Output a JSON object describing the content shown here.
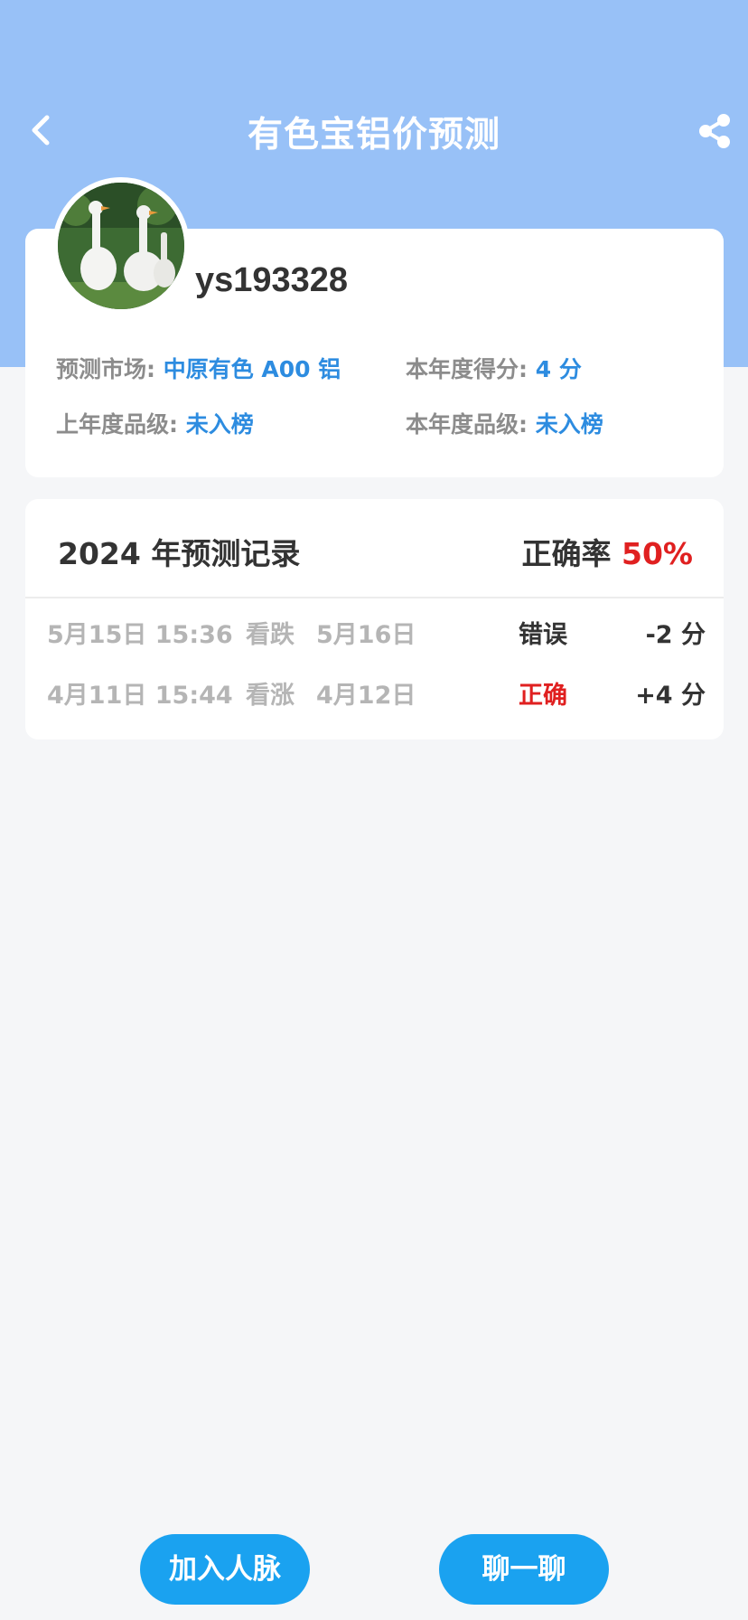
{
  "nav": {
    "title": "有色宝铝价预测"
  },
  "profile": {
    "username": "ys193328",
    "market_label": "预测市场:",
    "market_value": "中原有色 A00 铝",
    "score_label": "本年度得分:",
    "score_value": "4 分",
    "last_grade_label": "上年度品级:",
    "last_grade_value": "未入榜",
    "grade_label": "本年度品级:",
    "grade_value": "未入榜"
  },
  "records": {
    "title": "2024 年预测记录",
    "accuracy_label": "正确率",
    "accuracy_value": "50%",
    "rows": [
      {
        "time": "5月15日 15:36",
        "direction": "看跌",
        "target": "5月16日",
        "result": "错误",
        "points": "-2 分"
      },
      {
        "time": "4月11日 15:44",
        "direction": "看涨",
        "target": "4月12日",
        "result": "正确",
        "points": "+4 分"
      }
    ]
  },
  "actions": {
    "add_contact": "加入人脉",
    "chat": "聊一聊"
  },
  "colors": {
    "header": "#98c1f7",
    "accent_blue": "#2d8ce0",
    "button": "#1aa2f0",
    "red": "#e02020"
  },
  "icons": {
    "back": "chevron-left-icon",
    "share": "share-icon"
  }
}
